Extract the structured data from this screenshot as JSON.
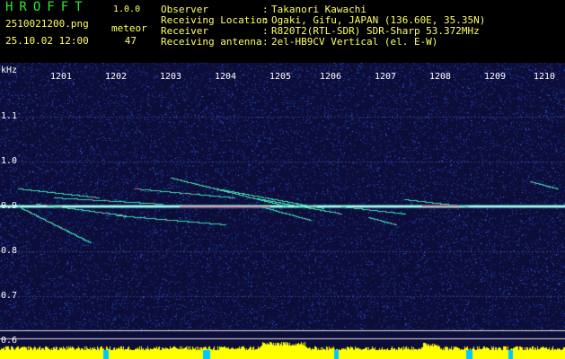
{
  "header": {
    "logo_text": "HROFFT",
    "version": "1.0.0",
    "filename": "2510021200.png",
    "timestamp": "25.10.02 12:00",
    "meteor_label": "meteor",
    "meteor_count": "47",
    "info": [
      {
        "label": "Observer",
        "sep": ":",
        "value": "Takanori Kawachi"
      },
      {
        "label": "Receiving Location",
        "sep": ":",
        "value": "Ogaki, Gifu, JAPAN (136.60E, 35.35N)"
      },
      {
        "label": "Receiver",
        "sep": ":",
        "value": "R820T2(RTL-SDR) SDR-Sharp 53.372MHz"
      },
      {
        "label": "Receiving antenna",
        "sep": ":",
        "value": "2el-HB9CV Vertical (el. E-W)"
      }
    ]
  },
  "spectrogram": {
    "freq_unit": "kHz",
    "time_ticks": [
      "1201",
      "1202",
      "1203",
      "1204",
      "1205",
      "1206",
      "1207",
      "1208",
      "1209",
      "1210"
    ],
    "freq_ticks": [
      "1.1",
      "1.0",
      "0.9",
      "0.8",
      "0.7",
      "0.6"
    ],
    "colors": {
      "background": "#0d0d3a",
      "noise": "#1c3fa8",
      "carrier": "#aaffee",
      "echo": "#33ddaa",
      "bright": "#ff4477",
      "level": "#ffff00"
    }
  }
}
